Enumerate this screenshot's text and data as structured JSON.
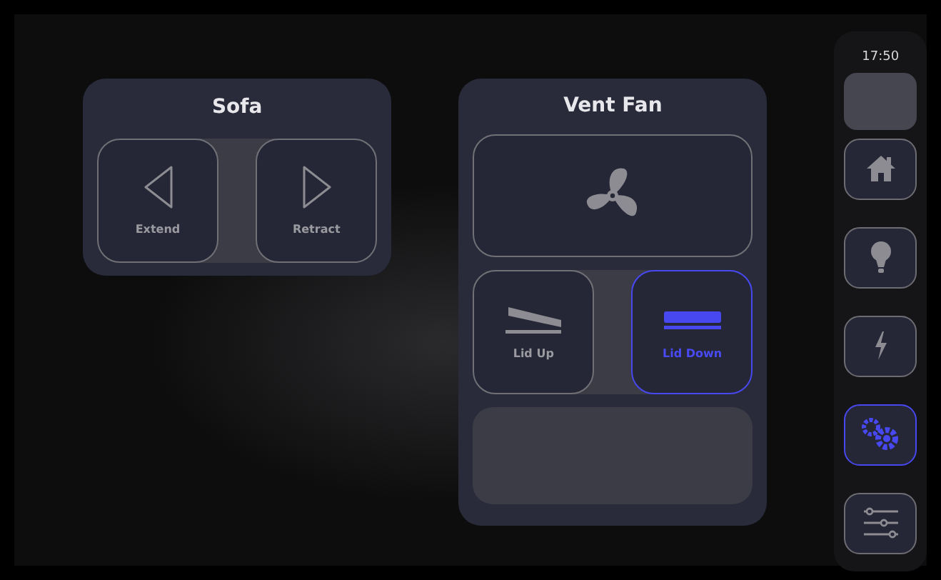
{
  "sofa": {
    "title": "Sofa",
    "buttons": [
      {
        "label": "Extend",
        "kind": "left",
        "selected": false
      },
      {
        "label": "Retract",
        "kind": "right",
        "selected": false
      }
    ]
  },
  "vent_fan": {
    "title": "Vent Fan",
    "lid_buttons": [
      {
        "label": "Lid Up",
        "kind": "up",
        "selected": false
      },
      {
        "label": "Lid Down",
        "kind": "down",
        "selected": true
      }
    ]
  },
  "sidebar": {
    "time": "17:50",
    "items": [
      {
        "kind": "home",
        "selected": false
      },
      {
        "kind": "bulb",
        "selected": false
      },
      {
        "kind": "bolt",
        "selected": false
      },
      {
        "kind": "gears",
        "selected": true
      },
      {
        "kind": "sliders",
        "selected": false
      }
    ]
  }
}
